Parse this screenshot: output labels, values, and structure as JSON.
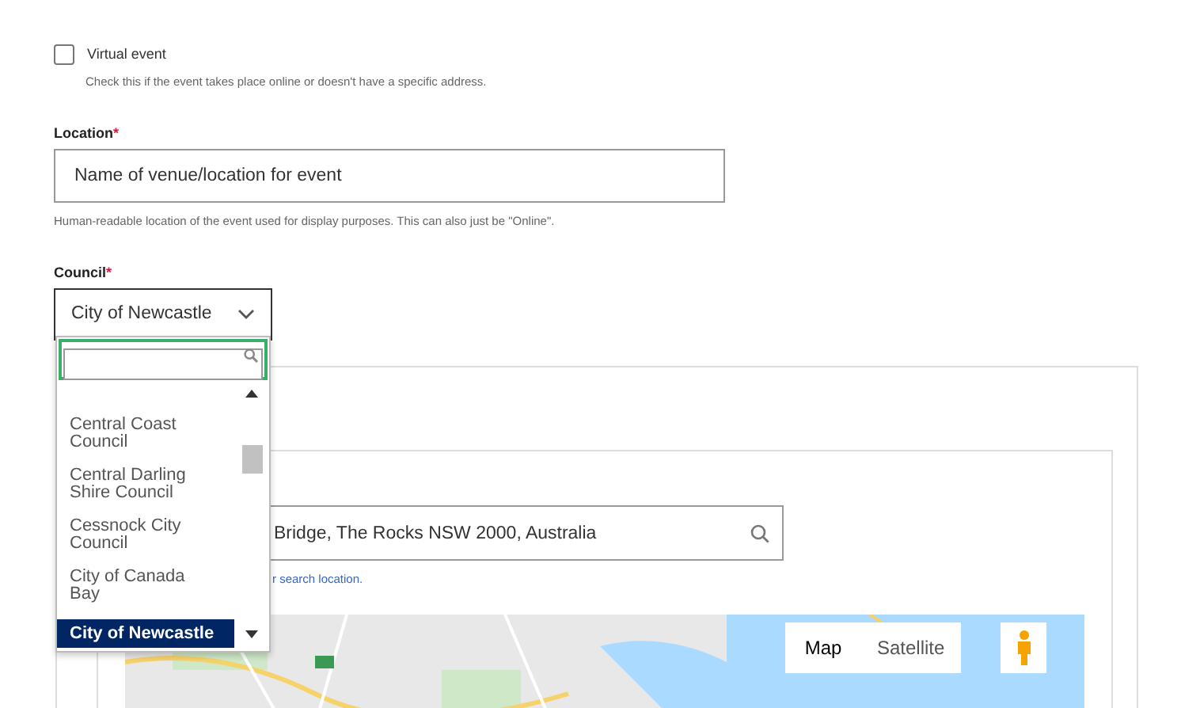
{
  "virtual_event": {
    "label": "Virtual event",
    "checked": false,
    "help": "Check this if the event takes place online or doesn't have a specific address."
  },
  "location": {
    "label": "Location",
    "required_mark": "*",
    "placeholder": "Name of venue/location for event",
    "help": "Human-readable location of the event used for display purposes. This can also just be \"Online\"."
  },
  "council": {
    "label": "Council",
    "required_mark": "*",
    "value": "City of Newcastle",
    "open": true,
    "options": [
      {
        "label": "Central Coast Council",
        "selected": false
      },
      {
        "label": "Central Darling Shire Council",
        "selected": false
      },
      {
        "label": "Cessnock City Council",
        "selected": false
      },
      {
        "label": "City of Canada Bay",
        "selected": false
      },
      {
        "label": "City of Newcastle",
        "selected": true
      }
    ]
  },
  "map_panel": {
    "search_value": "Bridge, The Rocks NSW 2000, Australia",
    "help": "r search location.",
    "map_types": [
      {
        "label": "Map",
        "selected": true
      },
      {
        "label": "Satellite",
        "selected": false
      }
    ]
  }
}
